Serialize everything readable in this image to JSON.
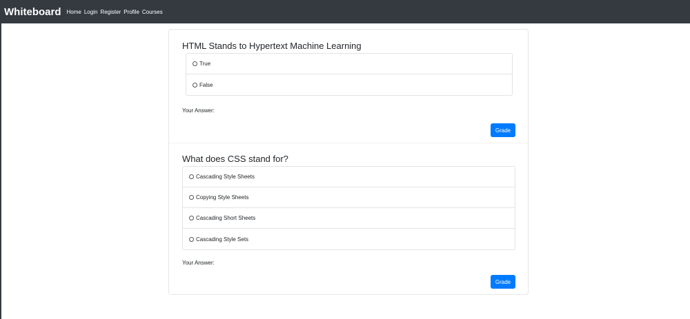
{
  "navbar": {
    "brand": "Whiteboard",
    "links": [
      "Home",
      "Login",
      "Register",
      "Profile",
      "Courses"
    ]
  },
  "questions": [
    {
      "title": "HTML Stands to Hypertext Machine Learning",
      "options": [
        "True",
        "False"
      ],
      "answer_label": "Your Answer:",
      "grade_label": "Grade"
    },
    {
      "title": "What does CSS stand for?",
      "options": [
        "Cascading Style Sheets",
        "Copying Style Sheets",
        "Cascading Short Sheets",
        "Cascading Style Sets"
      ],
      "answer_label": "Your Answer:",
      "grade_label": "Grade"
    }
  ],
  "colors": {
    "navbar": "#343a40",
    "primary": "#007bff"
  }
}
